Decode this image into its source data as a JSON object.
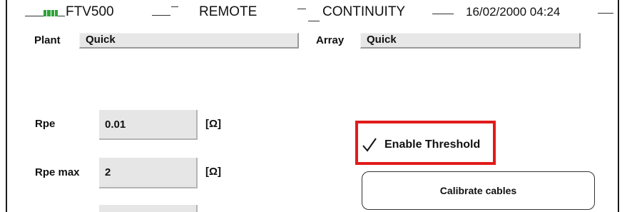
{
  "header": {
    "device": "FTV500",
    "mode": "REMOTE",
    "function": "CONTINUITY",
    "datetime": "16/02/2000 04:24"
  },
  "plant": {
    "label": "Plant",
    "value": "Quick"
  },
  "array": {
    "label": "Array",
    "value": "Quick"
  },
  "rpe": {
    "label": "Rpe",
    "value": "0.01",
    "unit": "[Ω]"
  },
  "rpe_max": {
    "label": "Rpe max",
    "value": "2",
    "unit": "[Ω]"
  },
  "enable_threshold": {
    "label": "Enable Threshold",
    "checked": true
  },
  "calibrate": {
    "label": "Calibrate cables"
  },
  "colors": {
    "highlight": "#e21b1b",
    "battery": "#2fa33a",
    "field": "#e7e7e7"
  }
}
